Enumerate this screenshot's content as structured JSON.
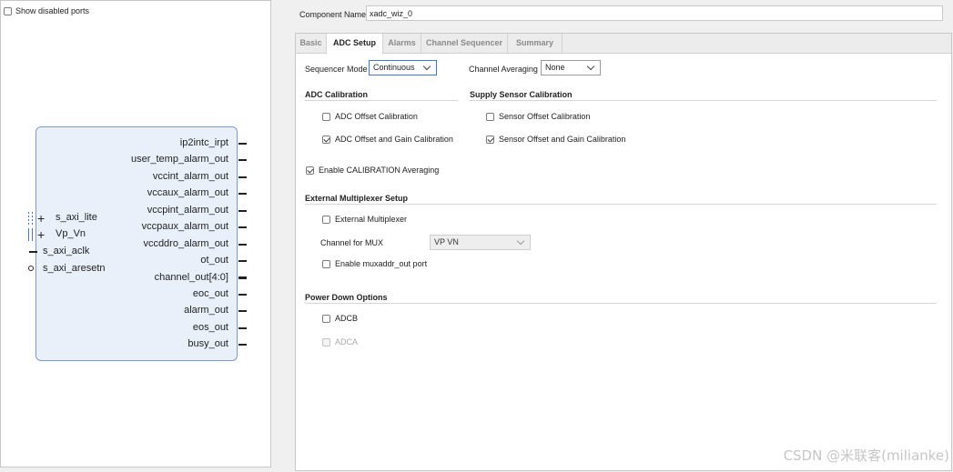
{
  "left": {
    "show_disabled_ports": "Show disabled ports",
    "ip_block": {
      "outputs": [
        "ip2intc_irpt",
        "user_temp_alarm_out",
        "vccint_alarm_out",
        "vccaux_alarm_out",
        "vccpint_alarm_out",
        "vccpaux_alarm_out",
        "vccddro_alarm_out",
        "ot_out",
        "channel_out[4:0]",
        "eoc_out",
        "alarm_out",
        "eos_out",
        "busy_out"
      ],
      "inputs": [
        "s_axi_lite",
        "Vp_Vn",
        "s_axi_aclk",
        "s_axi_aresetn"
      ]
    }
  },
  "right": {
    "component_name_label": "Component Name",
    "component_name_value": "xadc_wiz_0",
    "tabs": [
      "Basic",
      "ADC Setup",
      "Alarms",
      "Channel Sequencer",
      "Summary"
    ],
    "active_tab": "ADC Setup",
    "sequencer_mode_label": "Sequencer Mode",
    "sequencer_mode_value": "Continuous",
    "channel_averaging_label": "Channel Averaging",
    "channel_averaging_value": "None",
    "adc_calibration": {
      "title": "ADC Calibration",
      "offset": "ADC Offset Calibration",
      "offset_gain": "ADC Offset and Gain Calibration"
    },
    "supply_sensor_calibration": {
      "title": "Supply Sensor Calibration",
      "offset": "Sensor Offset Calibration",
      "offset_gain": "Sensor Offset and Gain Calibration"
    },
    "enable_calibration_averaging": "Enable CALIBRATION Averaging",
    "external_mux": {
      "title": "External Multiplexer Setup",
      "external_multiplexer": "External Multiplexer",
      "channel_for_mux_label": "Channel for MUX",
      "channel_for_mux_value": "VP VN",
      "enable_muxaddr": "Enable muxaddr_out port"
    },
    "power_down": {
      "title": "Power Down Options",
      "adcb": "ADCB",
      "adca": "ADCA"
    }
  },
  "watermark": "CSDN @米联客(milianke)"
}
